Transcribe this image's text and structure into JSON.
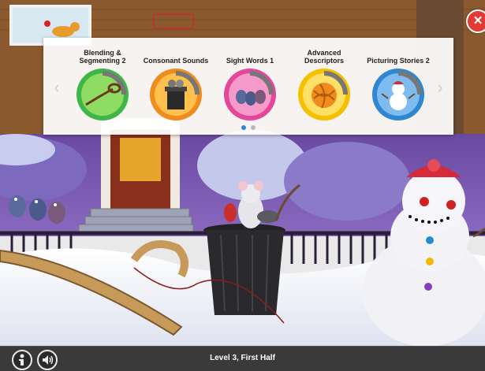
{
  "activities": [
    {
      "label": "Blending &\nSegmenting 2",
      "icon": "lasso-rope-icon",
      "ring_color": "#3fb54a",
      "ring_light": "#8fdc63"
    },
    {
      "label": "Consonant Sounds",
      "icon": "trash-can-icon",
      "ring_color": "#f08b1d",
      "ring_light": "#ffc04d"
    },
    {
      "label": "Sight Words 1",
      "icon": "pigeons-icon",
      "ring_color": "#e4469a",
      "ring_light": "#f59acb"
    },
    {
      "label": "Advanced\nDescriptors",
      "icon": "yarn-ball-icon",
      "ring_color": "#f5c000",
      "ring_light": "#ffe066"
    },
    {
      "label": "Picturing Stories 2",
      "icon": "snowman-icon",
      "ring_color": "#2f86d1",
      "ring_light": "#7ebcf0"
    }
  ],
  "carousel": {
    "pages": 2,
    "current_page": 1,
    "prev_icon": "chevron-left-icon",
    "next_icon": "chevron-right-icon"
  },
  "close_button": {
    "icon": "close-icon",
    "symbol": "×",
    "color": "#e23a34"
  },
  "bottom_bar": {
    "level_text": "Level 3, First Half",
    "info_icon": "info-person-icon",
    "audio_icon": "speaker-icon"
  }
}
